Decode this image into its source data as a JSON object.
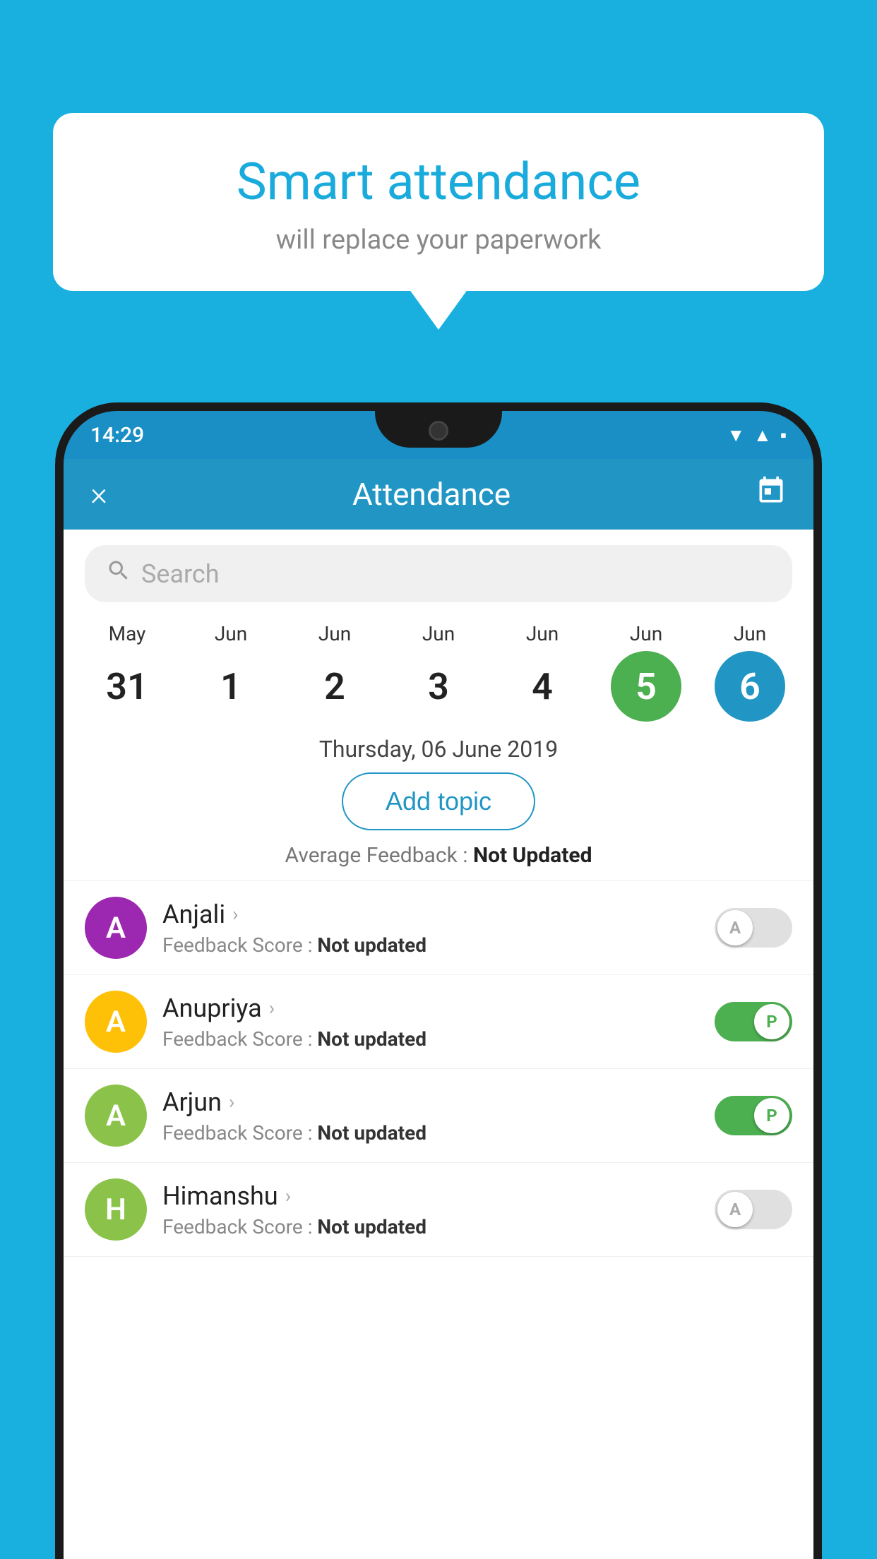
{
  "background_color": "#19b0e0",
  "speech_bubble": {
    "title": "Smart attendance",
    "subtitle": "will replace your paperwork"
  },
  "status_bar": {
    "time": "14:29",
    "icons": [
      "wifi",
      "signal",
      "battery"
    ]
  },
  "app_bar": {
    "title": "Attendance",
    "close_label": "×",
    "calendar_icon": "📅"
  },
  "search": {
    "placeholder": "Search"
  },
  "dates": [
    {
      "month": "May",
      "number": "31",
      "state": "normal"
    },
    {
      "month": "Jun",
      "number": "1",
      "state": "normal"
    },
    {
      "month": "Jun",
      "number": "2",
      "state": "normal"
    },
    {
      "month": "Jun",
      "number": "3",
      "state": "normal"
    },
    {
      "month": "Jun",
      "number": "4",
      "state": "normal"
    },
    {
      "month": "Jun",
      "number": "5",
      "state": "today"
    },
    {
      "month": "Jun",
      "number": "6",
      "state": "selected"
    }
  ],
  "selected_date_label": "Thursday, 06 June 2019",
  "add_topic_label": "Add topic",
  "avg_feedback_prefix": "Average Feedback : ",
  "avg_feedback_value": "Not Updated",
  "students": [
    {
      "name": "Anjali",
      "avatar_letter": "A",
      "avatar_color": "#9c27b0",
      "feedback_prefix": "Feedback Score : ",
      "feedback_value": "Not updated",
      "toggle_state": "off",
      "toggle_label": "A"
    },
    {
      "name": "Anupriya",
      "avatar_letter": "A",
      "avatar_color": "#ffc107",
      "feedback_prefix": "Feedback Score : ",
      "feedback_value": "Not updated",
      "toggle_state": "on",
      "toggle_label": "P"
    },
    {
      "name": "Arjun",
      "avatar_letter": "A",
      "avatar_color": "#8bc34a",
      "feedback_prefix": "Feedback Score : ",
      "feedback_value": "Not updated",
      "toggle_state": "on",
      "toggle_label": "P"
    },
    {
      "name": "Himanshu",
      "avatar_letter": "H",
      "avatar_color": "#8bc34a",
      "feedback_prefix": "Feedback Score : ",
      "feedback_value": "Not updated",
      "toggle_state": "off",
      "toggle_label": "A"
    }
  ]
}
